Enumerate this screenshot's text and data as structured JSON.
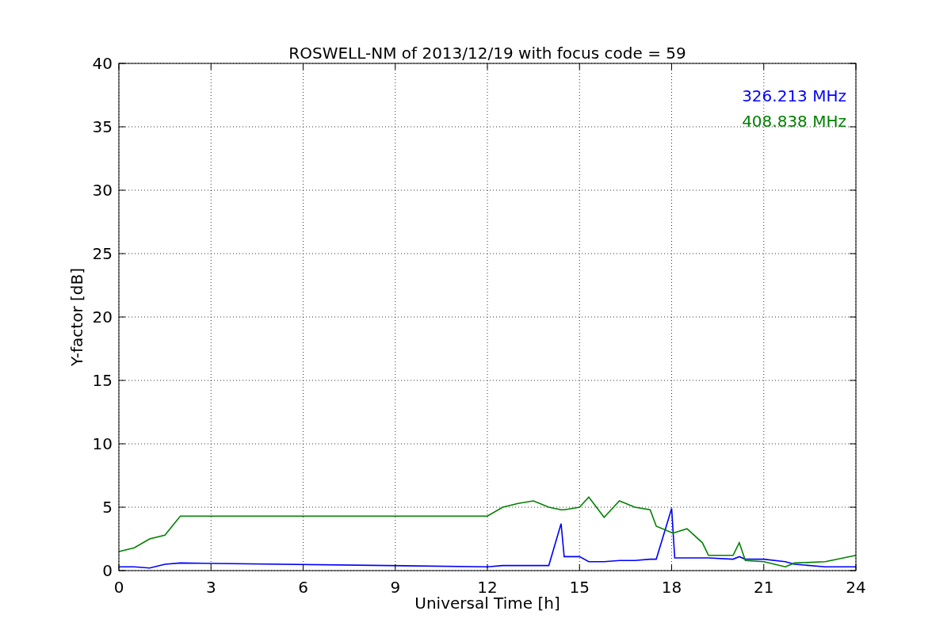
{
  "chart_data": {
    "type": "line",
    "title": "ROSWELL-NM of 2013/12/19 with focus code = 59",
    "xlabel": "Universal Time [h]",
    "ylabel": "Y-factor [dB]",
    "x": [
      0,
      0.5,
      1,
      1.5,
      2,
      12,
      12.5,
      13,
      13.5,
      14,
      14.4,
      14.5,
      15,
      15.3,
      15.8,
      16.3,
      16.8,
      17.3,
      17.5,
      18,
      18.1,
      18.5,
      19,
      19.2,
      20,
      20.2,
      20.4,
      21,
      21.7,
      22,
      23,
      24
    ],
    "series": [
      {
        "name": "326.213 MHz",
        "color": "#0000ff",
        "values": [
          0.3,
          0.3,
          0.2,
          0.5,
          0.6,
          0.3,
          0.4,
          0.4,
          0.4,
          0.4,
          3.7,
          1.1,
          1.1,
          0.7,
          0.7,
          0.8,
          0.8,
          0.9,
          0.9,
          4.9,
          1.0,
          1.0,
          1.0,
          1.0,
          0.9,
          1.1,
          0.9,
          0.9,
          0.7,
          0.5,
          0.3,
          0.3
        ]
      },
      {
        "name": "408.838 MHz",
        "color": "#008000",
        "values": [
          1.5,
          1.8,
          2.5,
          2.8,
          4.3,
          4.3,
          5.0,
          5.3,
          5.5,
          5.0,
          4.8,
          4.8,
          5.0,
          5.8,
          4.2,
          5.5,
          5.0,
          4.8,
          3.5,
          3.0,
          3.0,
          3.3,
          2.2,
          1.2,
          1.2,
          2.2,
          0.8,
          0.7,
          0.3,
          0.6,
          0.7,
          1.2
        ]
      }
    ],
    "grid": true,
    "xlim": [
      0,
      24
    ],
    "ylim": [
      0,
      40
    ],
    "xticks": [
      0,
      3,
      6,
      9,
      12,
      15,
      18,
      21,
      24
    ],
    "yticks": [
      0,
      5,
      10,
      15,
      20,
      25,
      30,
      35,
      40
    ]
  }
}
